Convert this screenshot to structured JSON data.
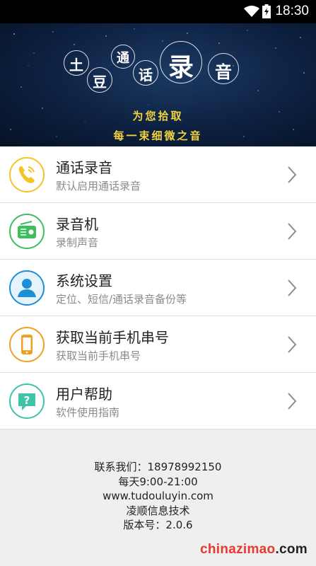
{
  "status_bar": {
    "time": "18:30"
  },
  "banner": {
    "logo_chars": [
      "土",
      "豆",
      "通",
      "话",
      "录",
      "音"
    ],
    "slogan_line1": "为您拾取",
    "slogan_line2": "每一束细微之音"
  },
  "menu": [
    {
      "title": "通话录音",
      "subtitle": "默认启用通话录音",
      "icon": "phone-icon",
      "color": "#f5c325"
    },
    {
      "title": "录音机",
      "subtitle": "录制声音",
      "icon": "radio-icon",
      "color": "#3cbf5c"
    },
    {
      "title": "系统设置",
      "subtitle": "定位、短信/通话录音备份等",
      "icon": "user-icon",
      "color": "#1e8fd6"
    },
    {
      "title": "获取当前手机串号",
      "subtitle": "获取当前手机串号",
      "icon": "smartphone-icon",
      "color": "#f0a020"
    },
    {
      "title": "用户帮助",
      "subtitle": "软件使用指南",
      "icon": "help-icon",
      "color": "#3ec5a8"
    }
  ],
  "footer": {
    "contact": "联系我们：18978992150",
    "hours": "每天9:00-21:00",
    "website": "www.tudouluyin.com",
    "company": "凌顺信息技术",
    "version": "版本号：2.0.6"
  },
  "watermark": {
    "text": "chinazimao",
    "suffix": ".com"
  }
}
